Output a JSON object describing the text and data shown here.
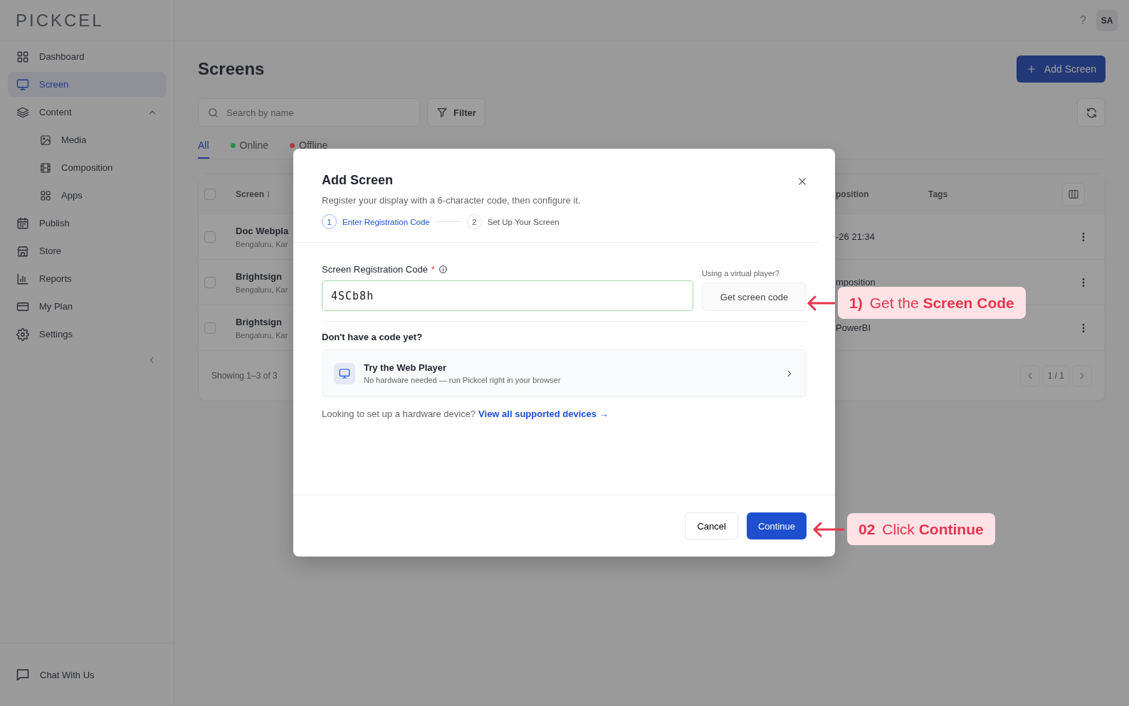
{
  "app": {
    "logo": "PICKCEL",
    "help": "?",
    "avatar": "SA"
  },
  "sidebar": {
    "items": [
      {
        "label": "Dashboard",
        "selected": false
      },
      {
        "label": "Screen",
        "selected": true
      },
      {
        "label": "Content",
        "selected": false,
        "expanded": true,
        "children": [
          {
            "label": "Media",
            "selected": false
          },
          {
            "label": "Composition",
            "selected": false
          },
          {
            "label": "Apps",
            "selected": false
          }
        ]
      },
      {
        "label": "Publish",
        "selected": false
      },
      {
        "label": "Store",
        "selected": false
      },
      {
        "label": "Reports",
        "selected": false
      },
      {
        "label": "My Plan",
        "selected": false
      },
      {
        "label": "Settings",
        "selected": false
      }
    ],
    "footer": "Chat With Us"
  },
  "page": {
    "title": "Screens",
    "add_button": "Add Screen",
    "search": {
      "placeholder": "Search by name"
    },
    "filter": "Filter",
    "tabs": [
      {
        "label": "All",
        "selected": true
      },
      {
        "label": "Online",
        "selected": false,
        "color": "#2e8a46"
      },
      {
        "label": "Offline",
        "selected": false,
        "color": "#b33b3b"
      }
    ]
  },
  "table": {
    "select_all": {
      "checked": false
    },
    "columns": [
      {
        "label": "Screen"
      },
      {
        "label": "position"
      },
      {
        "label": "Tags"
      }
    ],
    "rows": [
      {
        "checked": false,
        "name": "Doc Webpla",
        "location": "Bengaluru, Kar",
        "column_3": "-26 21:34"
      },
      {
        "checked": false,
        "name": "Brightsign",
        "location": "Bengaluru, Kar",
        "column_3": "mposition"
      },
      {
        "checked": false,
        "name": "Brightsign",
        "location": "Bengaluru, Kar",
        "column_3": "PowerBI"
      }
    ],
    "summary": "Showing 1–3 of 3",
    "pages": "1 / 1"
  },
  "modal": {
    "title": "Add Screen",
    "subtitle": "Register your display with a 6-character code, then configure it.",
    "steps": [
      {
        "number": "1",
        "label": "Enter Registration Code",
        "selected": true
      },
      {
        "number": "2",
        "label": "Set Up Your Screen",
        "selected": false
      }
    ],
    "field_label": "Screen Registration Code",
    "required": "*",
    "value": "4SCb8h",
    "virtual_hint": "Using a virtual player?",
    "get_code": "Get screen code",
    "no_code": "Don't have a code yet?",
    "web_player": {
      "title": "Try the Web Player",
      "subtitle": "No hardware needed — run Pickcel right in your browser"
    },
    "hardware_note": "Looking to set up a hardware device?",
    "hardware_link": "View all supported devices →",
    "cancel": "Cancel",
    "continue": "Continue"
  },
  "annotations": [
    {
      "number": "1)",
      "text": "Get the **Screen Code**"
    },
    {
      "number": "02",
      "text": "Click **Continue**"
    }
  ]
}
